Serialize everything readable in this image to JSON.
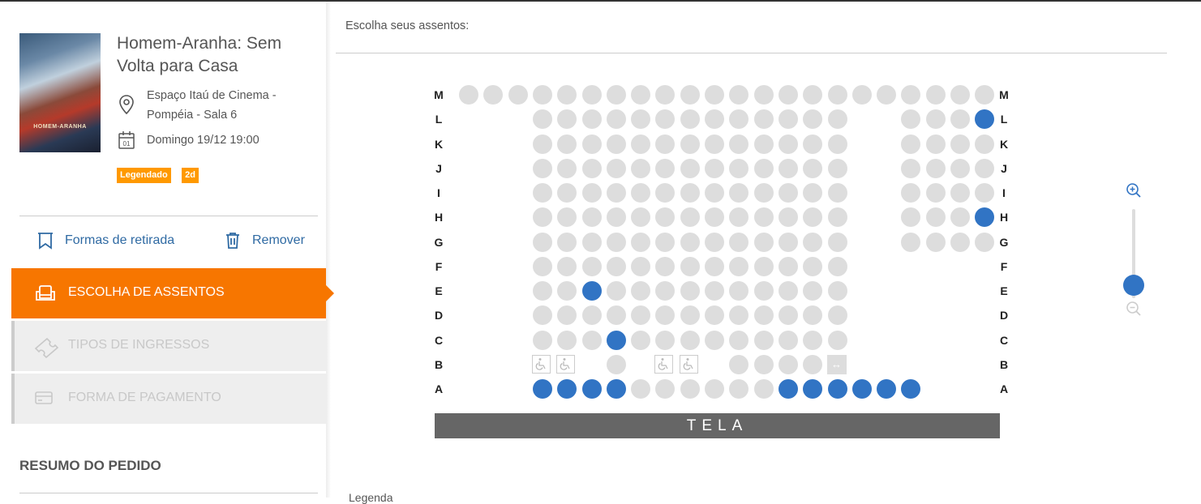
{
  "movie": {
    "title": "Homem-Aranha: Sem Volta para Casa",
    "poster_text": "HOMEM-ARANHA",
    "cinema": "Espaço Itaú de Cinema - Pompéia - Sala 6",
    "cinema_line1": "Espaço Itaú de Cinema -",
    "cinema_line2": "Pompéia - Sala 6",
    "datetime": "Domingo 19/12 19:00",
    "calendar_icon_day": "01",
    "badges": [
      "Legendado",
      "2d"
    ]
  },
  "actions": {
    "pickup_label": "Formas de retirada",
    "remove_label": "Remover"
  },
  "steps": [
    {
      "label": "ESCOLHA DE ASSENTOS",
      "state": "active"
    },
    {
      "label": "TIPOS DE INGRESSOS",
      "state": "disabled"
    },
    {
      "label": "FORMA DE PAGAMENTO",
      "state": "disabled"
    }
  ],
  "summary": {
    "title": "RESUMO DO PEDIDO"
  },
  "seat_map": {
    "heading": "Escolha seus assentos:",
    "screen_label": "TELA",
    "rows": [
      "M",
      "L",
      "K",
      "J",
      "I",
      "H",
      "G",
      "F",
      "E",
      "D",
      "C",
      "B",
      "A"
    ],
    "row_counts": {
      "M": 22,
      "L": 16,
      "K": 16,
      "J": 16,
      "I": 16,
      "H": 16,
      "G": 16,
      "F": 13,
      "E": 13,
      "D": 13,
      "C": 13,
      "B": 9,
      "A": 16
    },
    "taken_seats": [
      "L-last",
      "H-last",
      "E-3",
      "C-4",
      "A-1",
      "A-2",
      "A-3",
      "A-4",
      "A-11",
      "A-12",
      "A-13",
      "A-14",
      "A-15",
      "A-16"
    ],
    "wheelchair_seats": 4,
    "companion_seats": 1,
    "colors": {
      "available": "#dddddd",
      "taken": "#3174c4",
      "accent": "#f77600",
      "badge": "#ff9900"
    }
  },
  "legend": {
    "partial_text": "Legenda"
  },
  "icons": [
    "map-pin-icon",
    "calendar-icon",
    "ticket-holder-icon",
    "trash-icon",
    "seat-icon",
    "ticket-icon",
    "card-icon",
    "zoom-in-icon",
    "zoom-out-icon",
    "wheelchair-icon",
    "companion-icon"
  ]
}
